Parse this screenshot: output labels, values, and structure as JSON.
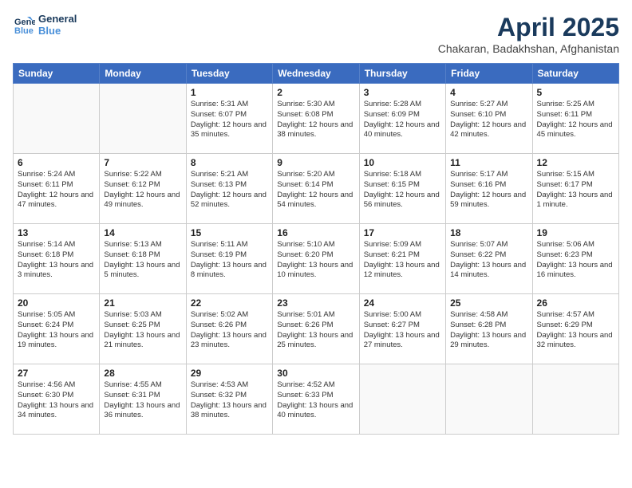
{
  "header": {
    "logo_line1": "General",
    "logo_line2": "Blue",
    "month": "April 2025",
    "location": "Chakaran, Badakhshan, Afghanistan"
  },
  "weekdays": [
    "Sunday",
    "Monday",
    "Tuesday",
    "Wednesday",
    "Thursday",
    "Friday",
    "Saturday"
  ],
  "weeks": [
    [
      {
        "day": "",
        "info": ""
      },
      {
        "day": "",
        "info": ""
      },
      {
        "day": "1",
        "info": "Sunrise: 5:31 AM\nSunset: 6:07 PM\nDaylight: 12 hours and 35 minutes."
      },
      {
        "day": "2",
        "info": "Sunrise: 5:30 AM\nSunset: 6:08 PM\nDaylight: 12 hours and 38 minutes."
      },
      {
        "day": "3",
        "info": "Sunrise: 5:28 AM\nSunset: 6:09 PM\nDaylight: 12 hours and 40 minutes."
      },
      {
        "day": "4",
        "info": "Sunrise: 5:27 AM\nSunset: 6:10 PM\nDaylight: 12 hours and 42 minutes."
      },
      {
        "day": "5",
        "info": "Sunrise: 5:25 AM\nSunset: 6:11 PM\nDaylight: 12 hours and 45 minutes."
      }
    ],
    [
      {
        "day": "6",
        "info": "Sunrise: 5:24 AM\nSunset: 6:11 PM\nDaylight: 12 hours and 47 minutes."
      },
      {
        "day": "7",
        "info": "Sunrise: 5:22 AM\nSunset: 6:12 PM\nDaylight: 12 hours and 49 minutes."
      },
      {
        "day": "8",
        "info": "Sunrise: 5:21 AM\nSunset: 6:13 PM\nDaylight: 12 hours and 52 minutes."
      },
      {
        "day": "9",
        "info": "Sunrise: 5:20 AM\nSunset: 6:14 PM\nDaylight: 12 hours and 54 minutes."
      },
      {
        "day": "10",
        "info": "Sunrise: 5:18 AM\nSunset: 6:15 PM\nDaylight: 12 hours and 56 minutes."
      },
      {
        "day": "11",
        "info": "Sunrise: 5:17 AM\nSunset: 6:16 PM\nDaylight: 12 hours and 59 minutes."
      },
      {
        "day": "12",
        "info": "Sunrise: 5:15 AM\nSunset: 6:17 PM\nDaylight: 13 hours and 1 minute."
      }
    ],
    [
      {
        "day": "13",
        "info": "Sunrise: 5:14 AM\nSunset: 6:18 PM\nDaylight: 13 hours and 3 minutes."
      },
      {
        "day": "14",
        "info": "Sunrise: 5:13 AM\nSunset: 6:18 PM\nDaylight: 13 hours and 5 minutes."
      },
      {
        "day": "15",
        "info": "Sunrise: 5:11 AM\nSunset: 6:19 PM\nDaylight: 13 hours and 8 minutes."
      },
      {
        "day": "16",
        "info": "Sunrise: 5:10 AM\nSunset: 6:20 PM\nDaylight: 13 hours and 10 minutes."
      },
      {
        "day": "17",
        "info": "Sunrise: 5:09 AM\nSunset: 6:21 PM\nDaylight: 13 hours and 12 minutes."
      },
      {
        "day": "18",
        "info": "Sunrise: 5:07 AM\nSunset: 6:22 PM\nDaylight: 13 hours and 14 minutes."
      },
      {
        "day": "19",
        "info": "Sunrise: 5:06 AM\nSunset: 6:23 PM\nDaylight: 13 hours and 16 minutes."
      }
    ],
    [
      {
        "day": "20",
        "info": "Sunrise: 5:05 AM\nSunset: 6:24 PM\nDaylight: 13 hours and 19 minutes."
      },
      {
        "day": "21",
        "info": "Sunrise: 5:03 AM\nSunset: 6:25 PM\nDaylight: 13 hours and 21 minutes."
      },
      {
        "day": "22",
        "info": "Sunrise: 5:02 AM\nSunset: 6:26 PM\nDaylight: 13 hours and 23 minutes."
      },
      {
        "day": "23",
        "info": "Sunrise: 5:01 AM\nSunset: 6:26 PM\nDaylight: 13 hours and 25 minutes."
      },
      {
        "day": "24",
        "info": "Sunrise: 5:00 AM\nSunset: 6:27 PM\nDaylight: 13 hours and 27 minutes."
      },
      {
        "day": "25",
        "info": "Sunrise: 4:58 AM\nSunset: 6:28 PM\nDaylight: 13 hours and 29 minutes."
      },
      {
        "day": "26",
        "info": "Sunrise: 4:57 AM\nSunset: 6:29 PM\nDaylight: 13 hours and 32 minutes."
      }
    ],
    [
      {
        "day": "27",
        "info": "Sunrise: 4:56 AM\nSunset: 6:30 PM\nDaylight: 13 hours and 34 minutes."
      },
      {
        "day": "28",
        "info": "Sunrise: 4:55 AM\nSunset: 6:31 PM\nDaylight: 13 hours and 36 minutes."
      },
      {
        "day": "29",
        "info": "Sunrise: 4:53 AM\nSunset: 6:32 PM\nDaylight: 13 hours and 38 minutes."
      },
      {
        "day": "30",
        "info": "Sunrise: 4:52 AM\nSunset: 6:33 PM\nDaylight: 13 hours and 40 minutes."
      },
      {
        "day": "",
        "info": ""
      },
      {
        "day": "",
        "info": ""
      },
      {
        "day": "",
        "info": ""
      }
    ]
  ]
}
